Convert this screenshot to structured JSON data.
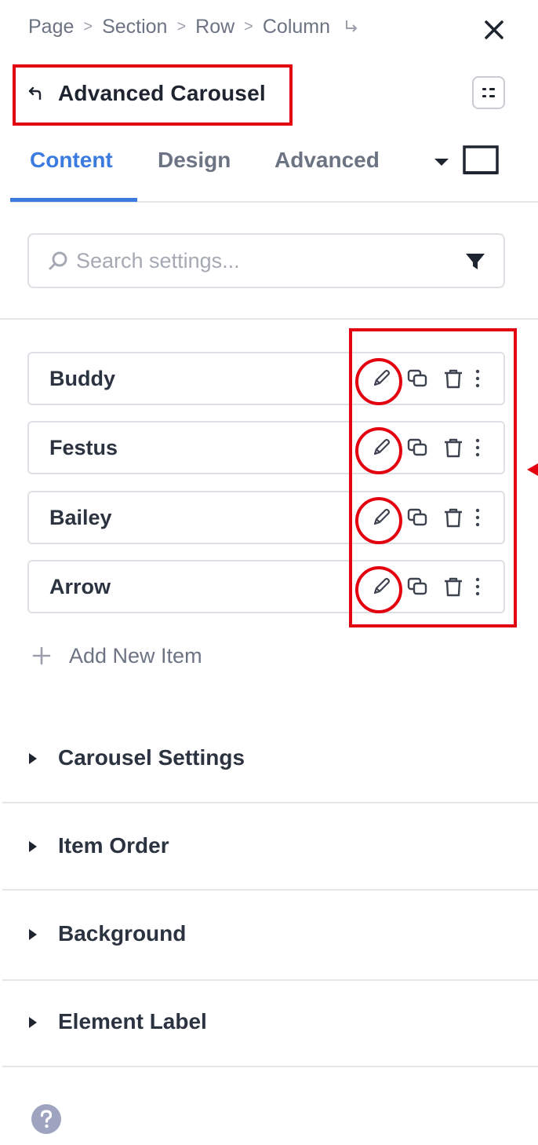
{
  "breadcrumb": {
    "items": [
      "Page",
      "Section",
      "Row",
      "Column"
    ],
    "separator": ">"
  },
  "panel": {
    "title": "Advanced Carousel"
  },
  "tabs": [
    {
      "label": "Content",
      "active": true
    },
    {
      "label": "Design",
      "active": false
    },
    {
      "label": "Advanced",
      "active": false
    }
  ],
  "search": {
    "placeholder": "Search settings...",
    "value": ""
  },
  "items": [
    {
      "label": "Buddy"
    },
    {
      "label": "Festus"
    },
    {
      "label": "Bailey"
    },
    {
      "label": "Arrow"
    }
  ],
  "add_item": {
    "label": "Add New Item"
  },
  "sections": [
    {
      "label": "Carousel Settings"
    },
    {
      "label": "Item Order"
    },
    {
      "label": "Background"
    },
    {
      "label": "Element Label"
    }
  ],
  "colors": {
    "accent": "#3b7be0",
    "annotation": "#e3000f",
    "muted_text": "#6c7382",
    "strong_text": "#2c3340"
  },
  "icons": {
    "close": "close-icon",
    "back": "back-icon",
    "options": "options-icon",
    "device": "desktop-icon",
    "filter": "filter-icon",
    "search": "search-icon",
    "edit": "pencil-icon",
    "duplicate": "duplicate-icon",
    "delete": "trash-icon",
    "more": "more-vertical-icon",
    "help": "help-icon"
  }
}
